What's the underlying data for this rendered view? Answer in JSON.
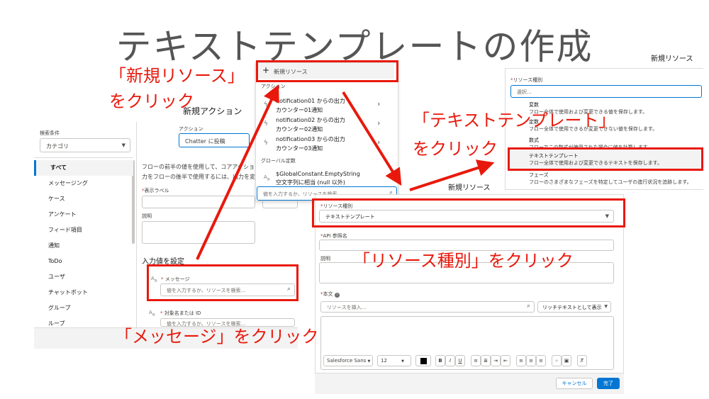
{
  "title": "テキストテンプレートの作成",
  "annotations": {
    "new_resource_line1": "「新規リソース」",
    "new_resource_line2": "をクリック",
    "text_template_line1": "「テキストテンプレート」",
    "text_template_line2": "をクリック",
    "resource_type": "「リソース種別」をクリック",
    "message": "「メッセージ」をクリック"
  },
  "left_panel": {
    "heading": "新規アクション",
    "filter_label": "検索条件",
    "category_value": "カテゴリ",
    "categories": [
      "すべて",
      "メッセージング",
      "ケース",
      "アンケート",
      "フィード項目",
      "通知",
      "ToDo",
      "ユーザ",
      "チャットボット",
      "グループ",
      "ループ"
    ],
    "action_label": "アクション",
    "action_value": "Chatter に投稿",
    "description_line1": "フローの前半の値を使用して、コアアクショ",
    "description_line2": "力をフローの後半で使用するには、出力を変",
    "display_label": "表示ラベル",
    "description_field": "説明",
    "input_section": "入力値を設定",
    "message_label": "メッセージ",
    "message_placeholder": "値を入力するか、リソースを検索...",
    "target_label": "対象名または ID",
    "target_placeholder": "値を入力するか、リソースを検索...",
    "required_mark": "*"
  },
  "dropdown": {
    "new_resource": "新規リソース",
    "section_action": "アクション",
    "items": [
      {
        "line1": "notification01 からの出力",
        "line2": "カウンター01通知"
      },
      {
        "line1": "notification02 からの出力",
        "line2": "カウンター02通知"
      },
      {
        "line1": "notification03 からの出力",
        "line2": "カウンター03通知"
      }
    ],
    "section_global": "グローバル定数",
    "global_item_line1": "$GlobalConstant.EmptyString",
    "global_item_line2": "空文字列に相当 (null 以外)",
    "search_placeholder": "値を入力するか、リソースを検索"
  },
  "resource_type_panel": {
    "heading": "新規リソース",
    "label": "リソース種別",
    "placeholder": "選択...",
    "options": [
      {
        "name": "変数",
        "desc": "フロー全体で使用および変更できる値を保存します。"
      },
      {
        "name": "定数",
        "desc": "フロー全体で使用できるが変更できない値を保存します。"
      },
      {
        "name": "数式",
        "desc": "フローでこの数式が使用された場合に値を計算します。"
      },
      {
        "name": "テキストテンプレート",
        "desc": "フロー全体で使用および変更できるテキストを保存します。"
      },
      {
        "name": "フェーズ",
        "desc": "フローのさまざまなフェーズを特定してユーザの進行状況を追跡します。"
      }
    ]
  },
  "bottom_panel": {
    "heading": "新規リソース",
    "resource_type_label": "リソース種別",
    "resource_type_value": "テキストテンプレート",
    "api_name_label": "API 参照名",
    "description_label": "説明",
    "body_label": "本文",
    "resource_insert_placeholder": "リソースを挿入...",
    "rich_text_label": "リッチテキストとして表示",
    "font_family": "Salesforce Sans",
    "font_size": "12",
    "cancel_label": "キャンセル",
    "done_label": "完了",
    "required_mark": "*"
  },
  "colors": {
    "accent_red": "#e8190c",
    "brand_blue": "#0176d3",
    "selected_blue": "#0176d3"
  }
}
